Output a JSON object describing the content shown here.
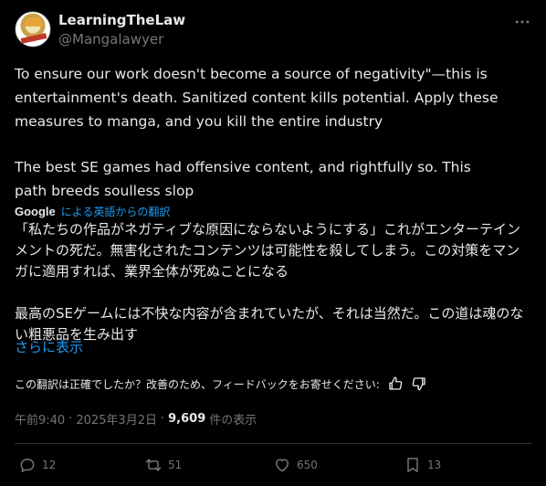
{
  "author": {
    "display_name": "LearningTheLaw",
    "handle": "@Mangalawyer"
  },
  "tweet": {
    "paragraph1": "To ensure our work doesn't become a source of negativity\"—this is entertainment's death. Sanitized content kills potential. Apply these measures to manga, and you kill the entire industry",
    "paragraph2": "The best SE games had offensive content, and rightfully so. This path breeds soulless slop"
  },
  "translation": {
    "provider": "Google",
    "label": "による英語からの翻訳",
    "paragraph1": "「私たちの作品がネガティブな原因にならないようにする」これがエンターテインメントの死だ。無害化されたコンテンツは可能性を殺してしまう。この対策をマンガに適用すれば、業界全体が死ぬことになる",
    "paragraph2": "最高のSEゲームには不快な内容が含まれていたが、それは当然だ。この道は魂のない粗悪品を生み出す",
    "show_more": "さらに表示",
    "feedback_prompt": "この翻訳は正確でしたか？改善のため、フィードバックをお寄せください:"
  },
  "meta": {
    "time": "午前9:40",
    "separator": "·",
    "date": "2025年3月2日",
    "views_count": "9,609",
    "views_label": "件の表示"
  },
  "actions": {
    "replies": "12",
    "reposts": "51",
    "likes": "650",
    "bookmarks": "13"
  },
  "icons": {
    "more": "more-horizontal-icon",
    "thumbs_up": "thumbs-up-icon",
    "thumbs_down": "thumbs-down-icon",
    "reply": "reply-icon",
    "repost": "repost-icon",
    "like": "heart-icon",
    "bookmark": "bookmark-icon"
  },
  "colors": {
    "background": "#000000",
    "text": "#e7e9ea",
    "secondary": "#71767b",
    "link": "#1d9bf0",
    "divider": "#2f3336"
  }
}
